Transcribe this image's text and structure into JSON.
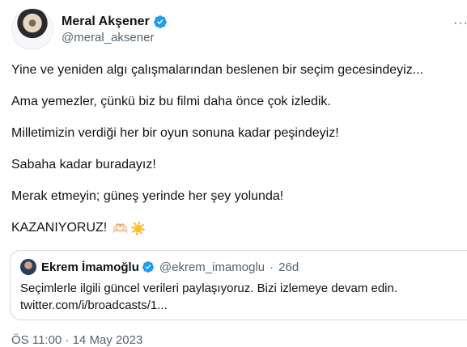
{
  "author": {
    "name": "Meral Akşener",
    "handle": "@meral_aksener"
  },
  "tweet": {
    "lines": [
      "Yine ve yeniden algı çalışmalarından beslenen bir seçim gecesindeyiz...",
      "Ama yemezler, çünkü biz bu filmi daha önce çok izledik.",
      "Milletimizin verdiği her bir oyun sonuna kadar peşindeyiz!",
      "Sabaha kadar buradayız!",
      "Merak etmeyin; güneş yerinde her şey yolunda!",
      "KAZANIYORUZ!"
    ],
    "emojis": [
      "🫶🏻",
      "☀️"
    ]
  },
  "quoted": {
    "name": "Ekrem İmamoğlu",
    "handle": "@ekrem_imamoglu",
    "separator": "·",
    "age": "26d",
    "text_line1": "Seçimlerle ilgili güncel verileri paylaşıyoruz. Bizi izlemeye devam edin.",
    "text_line2": "twitter.com/i/broadcasts/1..."
  },
  "meta": {
    "timestamp": "ÖS 11:00 · 14 May 2023"
  },
  "colors": {
    "verified": "#1d9bf0",
    "secondary_text": "#536471",
    "border": "#cfd9de"
  },
  "icons": [
    "verified-badge-icon",
    "more-options-icon"
  ]
}
